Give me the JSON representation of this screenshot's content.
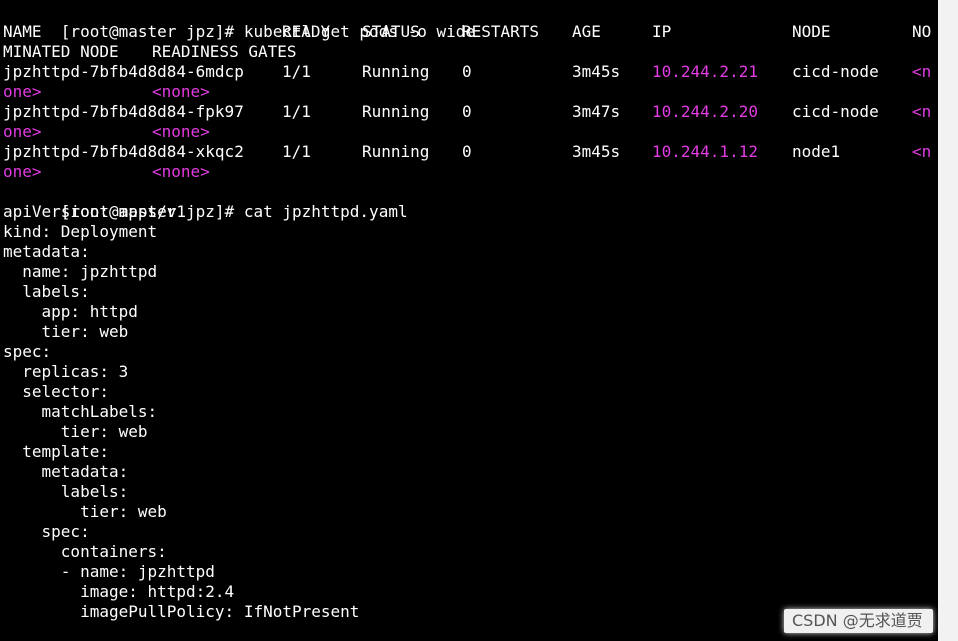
{
  "terminal": {
    "prompt": "[root@master jpz]# ",
    "commands": {
      "get_pods": "kubectl get pods -o wide",
      "cat_yaml": "cat jpzhttpd.yaml"
    },
    "headers": {
      "name": "NAME",
      "ready": "READY",
      "status": "STATUS",
      "restarts": "RESTARTS",
      "age": "AGE",
      "ip": "IP",
      "node": "NODE",
      "nominated_start": "NO",
      "nominated_rest": "MINATED NODE",
      "readiness_gates": "READINESS GATES"
    },
    "pods": [
      {
        "name": "jpzhttpd-7bfb4d8d84-6mdcp",
        "ready": "1/1",
        "status": "Running",
        "restarts": "0",
        "age": "3m45s",
        "ip": "10.244.2.21",
        "node": "cicd-node",
        "nominated_start": "<n",
        "nominated_end": "one>",
        "readiness": "<none>"
      },
      {
        "name": "jpzhttpd-7bfb4d8d84-fpk97",
        "ready": "1/1",
        "status": "Running",
        "restarts": "0",
        "age": "3m47s",
        "ip": "10.244.2.20",
        "node": "cicd-node",
        "nominated_start": "<n",
        "nominated_end": "one>",
        "readiness": "<none>"
      },
      {
        "name": "jpzhttpd-7bfb4d8d84-xkqc2",
        "ready": "1/1",
        "status": "Running",
        "restarts": "0",
        "age": "3m45s",
        "ip": "10.244.1.12",
        "node": "node1",
        "nominated_start": "<n",
        "nominated_end": "one>",
        "readiness": "<none>"
      }
    ],
    "yaml_lines": [
      "apiVersion: apps/v1",
      "kind: Deployment",
      "metadata:",
      "  name: jpzhttpd",
      "  labels:",
      "    app: httpd",
      "    tier: web",
      "spec:",
      "  replicas: 3",
      "  selector:",
      "    matchLabels:",
      "      tier: web",
      "  template:",
      "    metadata:",
      "      labels:",
      "        tier: web",
      "    spec:",
      "      containers:",
      "      - name: jpzhttpd",
      "        image: httpd:2.4",
      "        imagePullPolicy: IfNotPresent"
    ],
    "colors": {
      "background": "#000000",
      "foreground": "#ffffff",
      "highlight": "#e23ce2",
      "cursor": "#dcdcdc",
      "gutter": "#f2f2f2"
    }
  },
  "watermark": {
    "text": "CSDN @无求道贾"
  }
}
